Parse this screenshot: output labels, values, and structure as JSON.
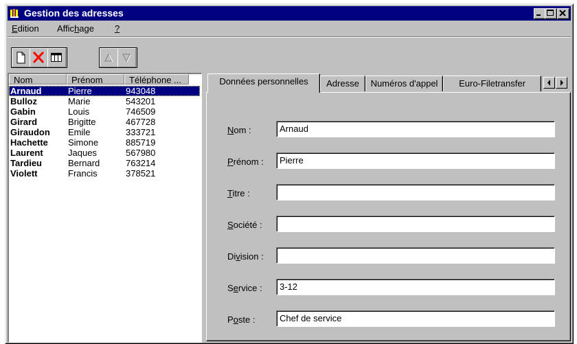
{
  "window": {
    "title": "Gestion des adresses"
  },
  "menu": {
    "items": [
      {
        "before": "",
        "accel": "E",
        "after": "dition"
      },
      {
        "before": "Affic",
        "accel": "h",
        "after": "age"
      },
      {
        "before": "",
        "accel": "?",
        "after": ""
      }
    ]
  },
  "toolbar": {
    "buttons": [
      "new-icon",
      "delete-icon",
      "columns-icon",
      "sort-up-icon",
      "sort-down-icon"
    ]
  },
  "list": {
    "columns": [
      "Nom",
      "Prénom",
      "Téléphone ..."
    ],
    "rows": [
      {
        "nom": "Arnaud",
        "prenom": "Pierre",
        "tel": "943048"
      },
      {
        "nom": "Bulloz",
        "prenom": "Marie",
        "tel": "543201"
      },
      {
        "nom": "Gabin",
        "prenom": "Louis",
        "tel": "746509"
      },
      {
        "nom": "Girard",
        "prenom": "Brigitte",
        "tel": "467728"
      },
      {
        "nom": "Giraudon",
        "prenom": "Emile",
        "tel": "333721"
      },
      {
        "nom": "Hachette",
        "prenom": "Simone",
        "tel": "885719"
      },
      {
        "nom": "Laurent",
        "prenom": "Jaques",
        "tel": "567980"
      },
      {
        "nom": "Tardieu",
        "prenom": "Bernard",
        "tel": "763214"
      },
      {
        "nom": "Violett",
        "prenom": "Francis",
        "tel": "378521"
      }
    ]
  },
  "tabs": [
    "Données personnelles",
    "Adresse",
    "Numéros d'appel",
    "Euro-Filetransfer"
  ],
  "form": {
    "fields": [
      {
        "before": "",
        "accel": "N",
        "after": "om :",
        "value": "Arnaud"
      },
      {
        "before": "",
        "accel": "P",
        "after": "rénom :",
        "value": "Pierre"
      },
      {
        "before": "",
        "accel": "T",
        "after": "itre :",
        "value": ""
      },
      {
        "before": "",
        "accel": "S",
        "after": "ociété :",
        "value": ""
      },
      {
        "before": "Di",
        "accel": "v",
        "after": "ision :",
        "value": ""
      },
      {
        "before": "S",
        "accel": "e",
        "after": "rvice :",
        "value": "3-12"
      },
      {
        "before": "P",
        "accel": "o",
        "after": "ste :",
        "value": "Chef de service"
      }
    ]
  },
  "colors": {
    "titlebar": "#000080",
    "face": "#c0c0c0",
    "selection": "#000080",
    "delete": "#ff0000"
  }
}
